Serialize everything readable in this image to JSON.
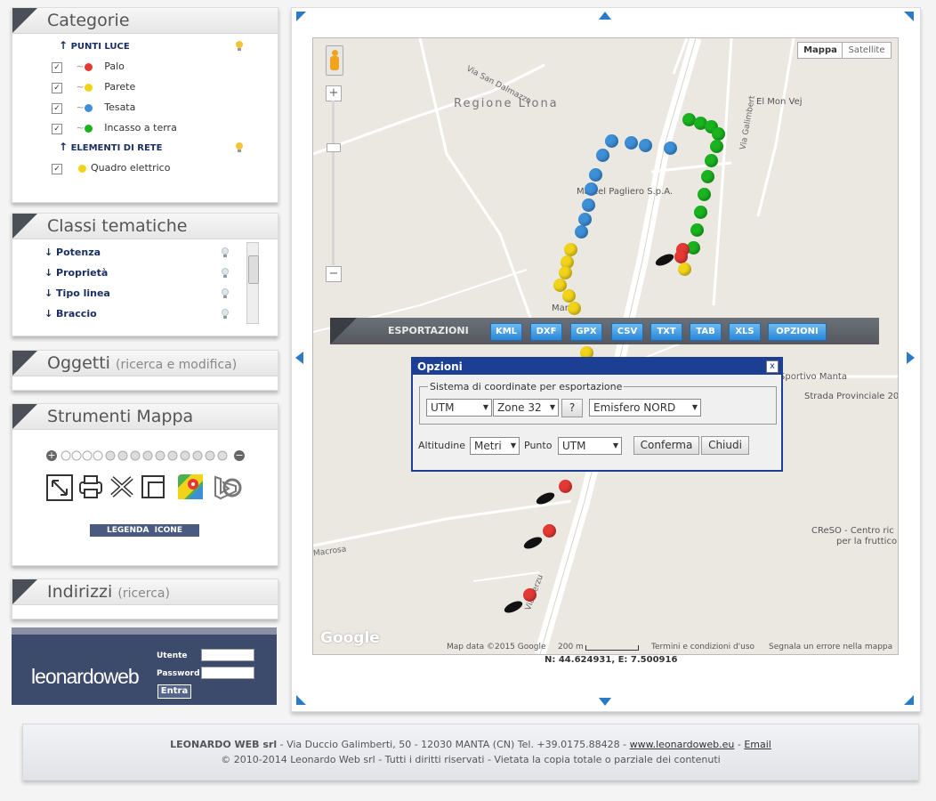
{
  "categorie": {
    "title": "Categorie",
    "group1": "PUNTI LUCE",
    "items1": [
      "Palo",
      "Parete",
      "Tesata",
      "Incasso a terra"
    ],
    "group2": "ELEMENTI DI RETE",
    "items2": [
      "Quadro elettrico"
    ],
    "pin_colors": [
      "#e53935",
      "#f1d41a",
      "#3d8fd8",
      "#19b31f",
      "#f1d41a"
    ]
  },
  "classi": {
    "title": "Classi tematiche",
    "items": [
      "Potenza",
      "Proprietà",
      "Tipo linea",
      "Braccio"
    ]
  },
  "oggetti": {
    "title": "Oggetti",
    "sub": "(ricerca e modifica)"
  },
  "strumenti": {
    "title": "Strumenti Mappa",
    "legend_button": "LEGENDA  ICONE"
  },
  "indirizzi": {
    "title": "Indirizzi",
    "sub": "(ricerca)"
  },
  "login": {
    "user_label": "Utente",
    "password_label": "Password",
    "enter": "Entra",
    "logo": "leonardoweb"
  },
  "map": {
    "type_map": "Mappa",
    "type_satellite": "Satellite",
    "labels": {
      "regione": "Regione Liona",
      "san_dalmazzo": "Via San Dalmazzo",
      "mon_vej": "El Mon Vej",
      "pagliero": "Marcel Pagliero S.p.A.",
      "manta": "Manta",
      "sportivo": "Sportivo Manta",
      "provinciale": "Strada Provinciale 20",
      "creso1": "CReSO - Centro ric",
      "creso2": "per la fruttico",
      "macrosa": "Macrosa",
      "vialbala": "Via Galimbert",
      "via_verzuolo": "Via Verzu",
      "google": "Google",
      "mapdata": "Map data ©2015 Google",
      "scale": "200 m",
      "terms": "Termini e condizioni d'uso",
      "report": "Segnala un errore nella mappa"
    },
    "coords": "N: 44.624931, E: 7.500916"
  },
  "export": {
    "label": "ESPORTAZIONI",
    "buttons": [
      "KML",
      "DXF",
      "GPX",
      "CSV",
      "TXT",
      "TAB",
      "XLS",
      "OPZIONI"
    ]
  },
  "dialog": {
    "title": "Opzioni",
    "close": "x",
    "group": "Sistema di coordinate per esportazione",
    "sys": "UTM",
    "zone": "Zone 32",
    "help": "?",
    "hemisphere": "Emisfero NORD",
    "alt_label": "Altitudine",
    "alt_value": "Metri",
    "point_label": "Punto",
    "point_value": "UTM",
    "confirm": "Conferma",
    "cancel": "Chiudi"
  },
  "footer": {
    "company": "LEONARDO WEB srl",
    "address": " - Via Duccio Galimberti, 50 - 12030 MANTA (CN) Tel. +39.0175.88428 - ",
    "site": "www.leonardoweb.eu",
    "sep": " - ",
    "email": "Email",
    "copyright": "© 2010-2014 Leonardo Web srl - Tutti i diritti riservati - Vietata la copia totale o parziale dei contenuti"
  },
  "colors": {
    "accent": "#1c3f94",
    "header_dark": "#4a4f58",
    "green": "#19b31f",
    "blue": "#3d8fd8",
    "yellow": "#f1d41a",
    "red": "#e53935"
  }
}
